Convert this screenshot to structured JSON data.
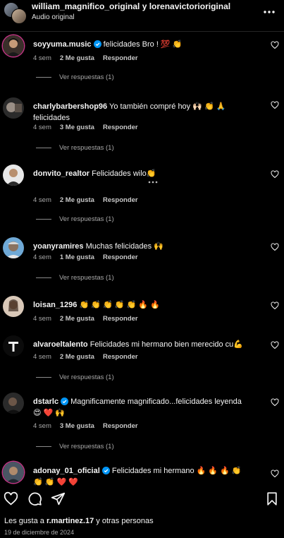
{
  "header": {
    "title": "william_magnifico_original y lorenavictorioriginal",
    "subtitle": "Audio original"
  },
  "comments": [
    {
      "username": "soyyuma.music",
      "verified": true,
      "text": "felicidades Bro ! 💯 👏",
      "age": "4 sem",
      "likes": "2 Me gusta",
      "reply": "Responder",
      "replies": "Ver respuestas (1)"
    },
    {
      "username": "charlybarbershop96",
      "verified": false,
      "text": "Yo también compré hoy 🙌🏻 👏 🙏 felicidades",
      "age": "4 sem",
      "likes": "3 Me gusta",
      "reply": "Responder",
      "replies": "Ver respuestas (1)"
    },
    {
      "username": "donvito_realtor",
      "verified": false,
      "text": "Felicidades wilo👏",
      "age": "4 sem",
      "likes": "2 Me gusta",
      "reply": "Responder",
      "replies": "Ver respuestas (1)"
    },
    {
      "username": "yoanyramires",
      "verified": false,
      "text": "Muchas felicidades 🙌",
      "age": "4 sem",
      "likes": "1 Me gusta",
      "reply": "Responder",
      "replies": "Ver respuestas (1)"
    },
    {
      "username": "loisan_1296",
      "verified": false,
      "text": "👏 👏 👏 👏 👏 🔥 🔥",
      "age": "4 sem",
      "likes": "2 Me gusta",
      "reply": "Responder",
      "replies": "Ver respuestas (1)"
    },
    {
      "username": "alvaroeltalento",
      "verified": false,
      "text": "Felicidades mi hermano bien merecido cu💪",
      "age": "4 sem",
      "likes": "2 Me gusta",
      "reply": "Responder",
      "replies": "Ver respuestas (1)"
    },
    {
      "username": "dstarlc",
      "verified": true,
      "text": "Magnificamente magnificado...felicidades leyenda 😍 ❤️ 🙌",
      "age": "4 sem",
      "likes": "3 Me gusta",
      "reply": "Responder",
      "replies": "Ver respuestas (1)"
    },
    {
      "username": "adonay_01_oficial",
      "verified": true,
      "text": "Felicidades mi hermano 🔥 🔥 🔥 👏 👏 👏 ❤️ ❤️"
    }
  ],
  "footer": {
    "likes_prefix": "Les gusta a",
    "likes_user": "r.martinez.17",
    "likes_suffix": "y otras personas",
    "date": "19 de diciembre de 2024"
  },
  "colors": {
    "background": "#000000",
    "verified": "#0095f6",
    "meta": "#a8a8a8"
  },
  "icons": [
    "more-vert-icon",
    "heart-icon",
    "comment-icon",
    "share-icon",
    "bookmark-icon",
    "verified-badge-icon"
  ]
}
